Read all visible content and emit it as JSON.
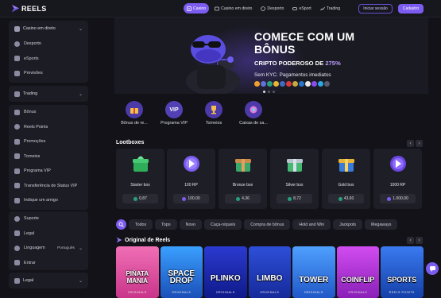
{
  "brand": {
    "logo_text": "REELS"
  },
  "nav": {
    "items": [
      {
        "label": "Casino",
        "icon": "casino-icon",
        "active": true
      },
      {
        "label": "Casino em direto",
        "icon": "live-casino-icon"
      },
      {
        "label": "Desporto",
        "icon": "sports-ball-icon"
      },
      {
        "label": "eSport",
        "icon": "gamepad-icon"
      },
      {
        "label": "Trading",
        "icon": "chart-icon"
      }
    ],
    "login_label": "Iniciar sessão",
    "signup_label": "Cadastro"
  },
  "sidebar": {
    "group1": {
      "header": "Casino em direto",
      "items": [
        "Desporto",
        "eSports",
        "Previsões"
      ]
    },
    "group2": {
      "header": "Trading",
      "items": [
        "Bônus",
        "Reels Points",
        "Promoções",
        "Torneios",
        "Programa VIP",
        "Transferência de Status VIP",
        "Indique um amigo"
      ]
    },
    "group3": {
      "items": [
        "Suporte",
        "Legal"
      ],
      "language_label": "Linguagem",
      "language_value": "Português",
      "enter_label": "Entrar"
    },
    "group4": {
      "header": "Legal"
    }
  },
  "hero": {
    "title": "COMECE COM UM BÔNUS",
    "subtitle_prefix": "CRIPTO PODEROSO DE",
    "subtitle_pct": "275%",
    "kyc_text": "Sem KYC. Pagamentos imediatos"
  },
  "categories": [
    {
      "label": "Bônus de re...",
      "icon": "gift-icon"
    },
    {
      "label": "Programa VIP",
      "icon": "vip-icon"
    },
    {
      "label": "Torneios",
      "icon": "trophy-icon"
    },
    {
      "label": "Caixas de sa...",
      "icon": "box-icon"
    }
  ],
  "lootboxes": {
    "title": "Lootboxes",
    "items": [
      {
        "name": "Starter box",
        "price": "0,87",
        "color": "#2fae5a",
        "price_icon": "tether"
      },
      {
        "name": "100 RP",
        "price": "100,00",
        "color": "#7c5cf0",
        "price_icon": "rp"
      },
      {
        "name": "Bronze box",
        "price": "4,36",
        "color": "#3aa86a",
        "price_icon": "tether"
      },
      {
        "name": "Silver box",
        "price": "8,72",
        "color": "#45b874",
        "price_icon": "tether"
      },
      {
        "name": "Gold box",
        "price": "43,60",
        "color": "#e7b23a",
        "price_icon": "tether"
      },
      {
        "name": "1000 RP",
        "price": "1.000,00",
        "color": "#7c5cf0",
        "price_icon": "rp"
      }
    ]
  },
  "filters": [
    "Todos",
    "Topo",
    "Novo",
    "Caça-níqueis",
    "Compra de bônus",
    "Hold and Win",
    "Jackpots",
    "Megaways"
  ],
  "originals": {
    "title": "Original de Reels",
    "games": [
      {
        "title": "PIÑATA MANIA",
        "sub": "ORIGINALS",
        "bg": "#d6429a"
      },
      {
        "title": "SPACE DROP",
        "sub": "ORIGINALS",
        "bg": "#1e6fd8"
      },
      {
        "title": "PLINKO",
        "sub": "ORIGINALS",
        "bg": "#1a2fb0"
      },
      {
        "title": "LIMBO",
        "sub": "ORIGINALS",
        "bg": "#1c3fbe"
      },
      {
        "title": "TOWER",
        "sub": "ORIGINALS",
        "bg": "#2b6fe0"
      },
      {
        "title": "COINFLIP",
        "sub": "ORIGINALS",
        "bg": "#b12bd8"
      },
      {
        "title": "SPORTS",
        "sub": "REELS POINTS",
        "bg": "#1b56c8"
      }
    ]
  }
}
